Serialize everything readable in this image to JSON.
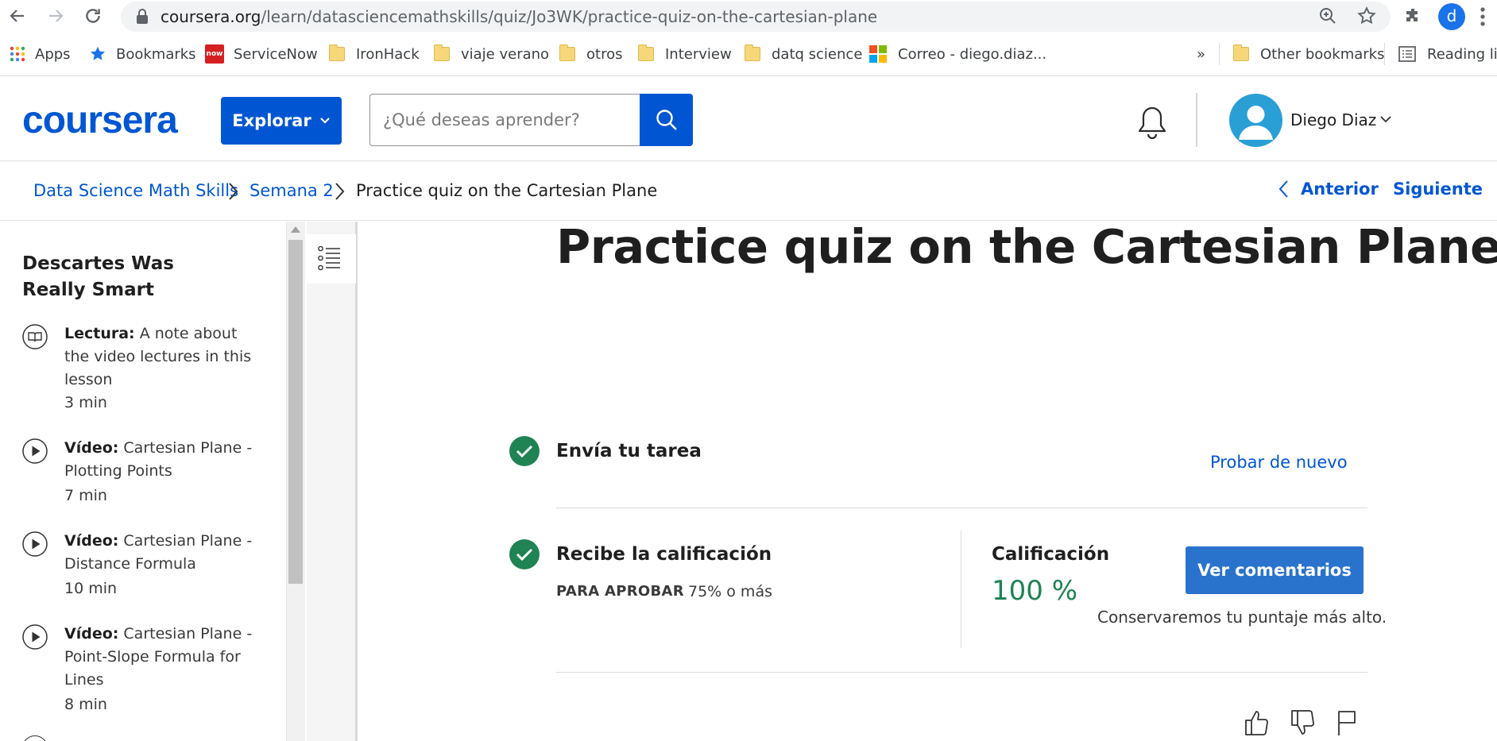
{
  "browser": {
    "url_host": "coursera.org",
    "url_path": "/learn/datasciencemathskills/quiz/Jo3WK/practice-quiz-on-the-cartesian-plane",
    "profile_initial": "d",
    "bookmarks": [
      {
        "label": "Apps",
        "icon": "apps-grid-icon"
      },
      {
        "label": "Bookmarks",
        "icon": "star-icon"
      },
      {
        "label": "ServiceNow",
        "icon": "servicenow-icon"
      },
      {
        "label": "IronHack",
        "icon": "folder-icon"
      },
      {
        "label": "viaje verano",
        "icon": "folder-icon"
      },
      {
        "label": "otros",
        "icon": "folder-icon"
      },
      {
        "label": "Interview",
        "icon": "folder-icon"
      },
      {
        "label": "datq science",
        "icon": "folder-icon"
      },
      {
        "label": "Correo - diego.diaz...",
        "icon": "microsoft-icon"
      }
    ],
    "overflow": "»",
    "other_bookmarks": "Other bookmarks",
    "reading_list": "Reading list"
  },
  "header": {
    "logo": "coursera",
    "explore_label": "Explorar",
    "search_placeholder": "¿Qué deseas aprender?",
    "user_name": "Diego Diaz"
  },
  "breadcrumb": {
    "items": [
      "Data Science Math Skills",
      "Semana 2",
      "Practice quiz on the Cartesian Plane"
    ],
    "prev_label": "Anterior",
    "next_label": "Siguiente"
  },
  "sidebar": {
    "title": "Descartes Was Really Smart",
    "items": [
      {
        "type": "Lectura:",
        "title": "A note about the video lectures in this lesson",
        "duration": "3 min",
        "icon": "book-icon"
      },
      {
        "type": "Vídeo:",
        "title": "Cartesian Plane - Plotting Points",
        "duration": "7 min",
        "icon": "play-circle-icon"
      },
      {
        "type": "Vídeo:",
        "title": "Cartesian Plane - Distance Formula",
        "duration": "10 min",
        "icon": "play-circle-icon"
      },
      {
        "type": "Vídeo:",
        "title": "Cartesian Plane - Point-Slope Formula for Lines",
        "duration": "8 min",
        "icon": "play-circle-icon"
      }
    ]
  },
  "main": {
    "title": "Practice quiz on the Cartesian Plane",
    "submit_step": "Envía tu tarea",
    "retry_label": "Probar de nuevo",
    "grade_step": "Recibe la calificación",
    "pass_label": "PARA APROBAR",
    "pass_value": "75% o más",
    "grade_label": "Calificación",
    "grade_value": "100 %",
    "feedback_button": "Ver comentarios",
    "keep_note": "Conservaremos tu puntaje más alto."
  },
  "colors": {
    "brand": "#0056d2",
    "success": "#1f8354",
    "button": "#2a73cc"
  }
}
